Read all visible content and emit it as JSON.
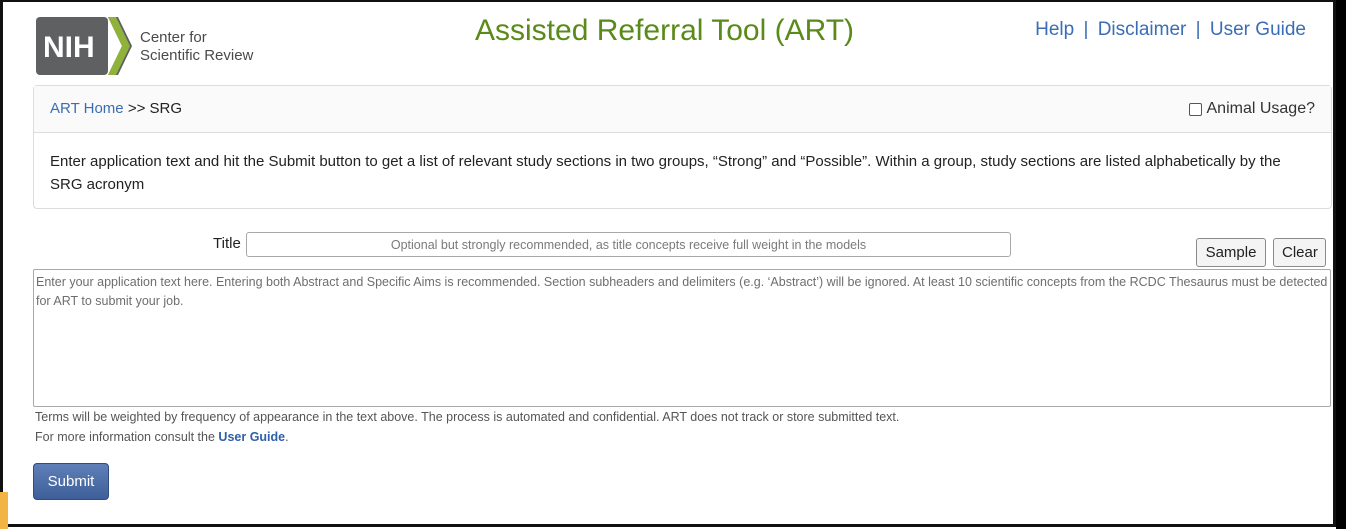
{
  "header": {
    "logo_mark": "NIH",
    "logo_line1": "Center for",
    "logo_line2": "Scientific Review",
    "title": "Assisted Referral Tool (ART)",
    "links": {
      "help": "Help",
      "disclaimer": "Disclaimer",
      "user_guide": "User Guide",
      "separator": "|"
    }
  },
  "breadcrumb": {
    "home": "ART Home",
    "separator": ">>",
    "current": "SRG"
  },
  "animal_usage": {
    "label": "Animal Usage?",
    "checked": false
  },
  "instructions": "Enter application text and hit the Submit button to get a list of relevant study sections in two groups, “Strong” and “Possible”. Within a group, study sections are listed alphabetically by the SRG acronym",
  "form": {
    "title_label": "Title",
    "title_value": "",
    "title_placeholder": "Optional but strongly recommended, as title concepts receive full weight in the models",
    "sample_label": "Sample",
    "clear_label": "Clear",
    "text_value": "",
    "text_placeholder": "Enter your application text here. Entering both Abstract and Specific Aims is recommended. Section subheaders and delimiters (e.g. ‘Abstract’) will be ignored. At least 10 scientific concepts from the RCDC Thesaurus must be detected for ART to submit your job.",
    "note1": "Terms will be weighted by frequency of appearance in the text above. The process is automated and confidential. ART does not track or store submitted text.",
    "note2_prefix": "For more information consult the ",
    "note2_link": "User Guide",
    "note2_suffix": ".",
    "submit_label": "Submit"
  },
  "colors": {
    "title_green": "#5a8a19",
    "link_blue": "#3a6db5",
    "submit_blue": "#4a6ba6"
  }
}
